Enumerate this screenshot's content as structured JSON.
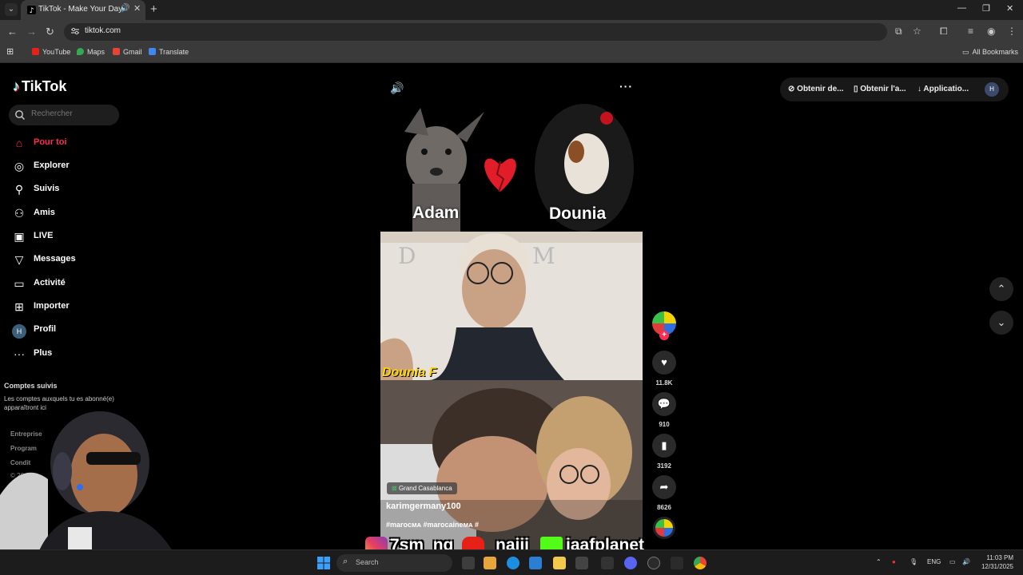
{
  "browser": {
    "tab_title": "TikTok - Make Your Day",
    "url": "tiktok.com",
    "bookmarks": [
      "YouTube",
      "Maps",
      "Gmail",
      "Translate"
    ],
    "all_bookmarks": "All Bookmarks"
  },
  "tiktok": {
    "logo": "TikTok",
    "search_placeholder": "Rechercher",
    "nav": [
      {
        "label": "Pour toi",
        "icon": "home-icon"
      },
      {
        "label": "Explorer",
        "icon": "compass-icon"
      },
      {
        "label": "Suivis",
        "icon": "following-icon"
      },
      {
        "label": "Amis",
        "icon": "friends-icon"
      },
      {
        "label": "LIVE",
        "icon": "live-icon"
      },
      {
        "label": "Messages",
        "icon": "messages-icon"
      },
      {
        "label": "Activité",
        "icon": "activity-icon"
      },
      {
        "label": "Importer",
        "icon": "upload-icon"
      },
      {
        "label": "Profil",
        "icon": "profile-icon"
      },
      {
        "label": "Plus",
        "icon": "more-icon"
      }
    ],
    "profile_initial": "H",
    "following_title": "Comptes suivis",
    "following_desc": "Les comptes auxquels tu es abonné(e) apparaîtront ici",
    "footer_links": [
      "Entreprise",
      "Program",
      "Condit",
      "© 20"
    ],
    "top_actions": [
      "Obtenir de...",
      "Obtenir l'a...",
      "Applicatio..."
    ],
    "video": {
      "name_left": "Adam",
      "name_right": "Dounia",
      "caption_overlay": "Dounia F",
      "location": "Grand Casablanca",
      "author": "karimgermany100",
      "hashtags": "#marocᴍᴀ #marocaineᴍᴀ #"
    },
    "actions": {
      "likes": "11.8K",
      "comments": "910",
      "saves": "3192",
      "shares": "8626"
    }
  },
  "overlay": {
    "instagram": "7sm_ng",
    "youtube": "najij",
    "kick": "jaafplanet"
  },
  "taskbar": {
    "search": "Search",
    "lang": "ENG",
    "time": "11:03 PM",
    "date": "12/31/2025"
  },
  "colors": {
    "accent": "#fe2c55",
    "background": "#000000"
  }
}
